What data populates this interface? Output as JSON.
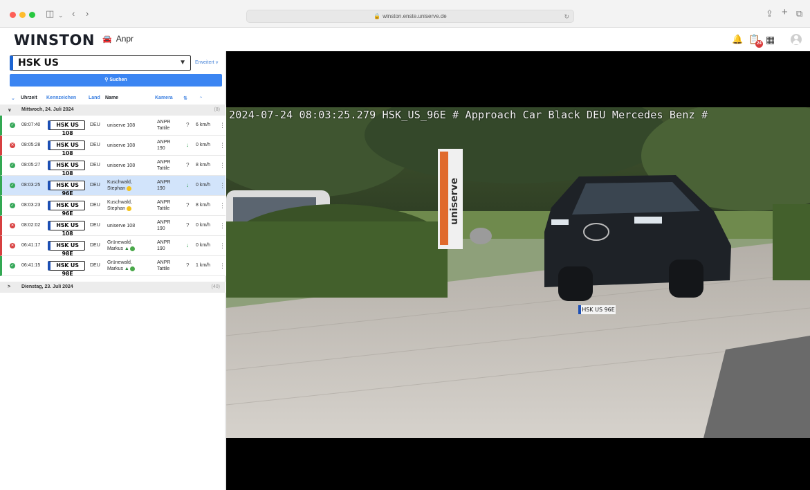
{
  "browser": {
    "url": "winston.enste.uniserve.de"
  },
  "header": {
    "logo": "WINSTON",
    "module": "Anpr",
    "notification_badge": "24"
  },
  "search": {
    "value": "HSK US",
    "advanced_label": "Erweitert",
    "button_label": "Suchen"
  },
  "table": {
    "columns": {
      "time": "Uhrzeit",
      "plate": "Kennzeichen",
      "country": "Land",
      "name": "Name",
      "camera": "Kamera"
    },
    "groups": [
      {
        "label": "Mittwoch, 24. Juli 2024",
        "count": "(8)"
      },
      {
        "label": "Dienstag, 23. Juli 2024",
        "count": "(40)"
      }
    ],
    "rows": [
      {
        "status": "ok",
        "time": "08:07:40",
        "plate": "HSK US 108",
        "country": "DEU",
        "name1": "uniserve 108",
        "name2": "",
        "cam1": "ANPR",
        "cam2": "Tattile",
        "dir": "?",
        "speed": "6 km/h"
      },
      {
        "status": "err",
        "time": "08:05:28",
        "plate": "HSK US 108",
        "country": "DEU",
        "name1": "uniserve 108",
        "name2": "",
        "cam1": "ANPR",
        "cam2": "190",
        "dir": "↓",
        "speed": "0 km/h"
      },
      {
        "status": "ok",
        "time": "08:05:27",
        "plate": "HSK US 108",
        "country": "DEU",
        "name1": "uniserve 108",
        "name2": "",
        "cam1": "ANPR",
        "cam2": "Tattile",
        "dir": "?",
        "speed": "8 km/h"
      },
      {
        "status": "ok",
        "time": "08:03:25",
        "plate": "HSK US 96E",
        "country": "DEU",
        "name1": "Kuschwald,",
        "name2": "Stephan",
        "cam1": "ANPR",
        "cam2": "190",
        "dir": "↓",
        "speed": "0 km/h"
      },
      {
        "status": "ok",
        "time": "08:03:23",
        "plate": "HSK US 96E",
        "country": "DEU",
        "name1": "Kuschwald,",
        "name2": "Stephan",
        "cam1": "ANPR",
        "cam2": "Tattile",
        "dir": "?",
        "speed": "8 km/h"
      },
      {
        "status": "err",
        "time": "08:02:02",
        "plate": "HSK US 108",
        "country": "DEU",
        "name1": "uniserve 108",
        "name2": "",
        "cam1": "ANPR",
        "cam2": "190",
        "dir": "?",
        "speed": "0 km/h"
      },
      {
        "status": "err",
        "time": "06:41:17",
        "plate": "HSK US 98E",
        "country": "DEU",
        "name1": "Grünewald,",
        "name2": "Markus",
        "cam1": "ANPR",
        "cam2": "190",
        "dir": "↓",
        "speed": "0 km/h"
      },
      {
        "status": "ok",
        "time": "06:41:15",
        "plate": "HSK US 98E",
        "country": "DEU",
        "name1": "Grünewald,",
        "name2": "Markus",
        "cam1": "ANPR",
        "cam2": "Tattile",
        "dir": "?",
        "speed": "1 km/h"
      }
    ]
  },
  "viewer": {
    "overlay": "2024-07-24 08:03:25.279 HSK_US_96E # Approach Car Black DEU Mercedes Benz #",
    "plate": "HSK US 96E",
    "sign": "uniserve"
  },
  "colors": {
    "accent": "#3b85f2",
    "ok": "#37a85a",
    "error": "#d94141",
    "selected_row": "#d2e4fb"
  }
}
